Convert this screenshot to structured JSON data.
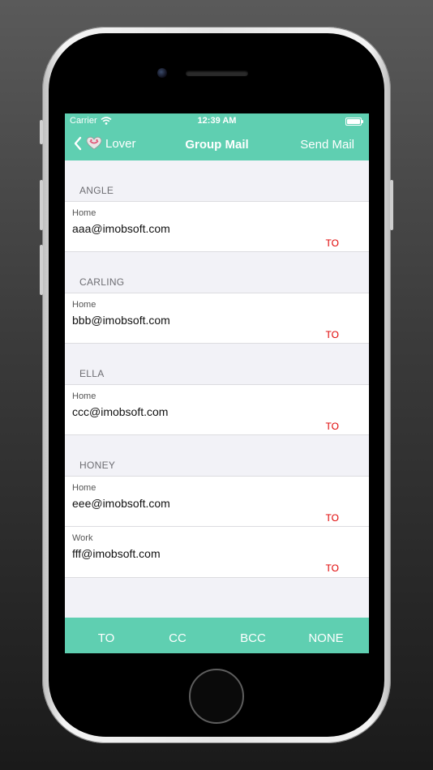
{
  "status": {
    "carrier": "Carrier",
    "time": "12:39 AM"
  },
  "nav": {
    "back_label": "Lover",
    "title": "Group Mail",
    "send_label": "Send Mail"
  },
  "sections": [
    {
      "header": "ANGLE",
      "rows": [
        {
          "label": "Home",
          "email": "aaa@imobsoft.com",
          "recipient": "TO"
        }
      ]
    },
    {
      "header": "CARLING",
      "rows": [
        {
          "label": "Home",
          "email": "bbb@imobsoft.com",
          "recipient": "TO"
        }
      ]
    },
    {
      "header": "ELLA",
      "rows": [
        {
          "label": "Home",
          "email": "ccc@imobsoft.com",
          "recipient": "TO"
        }
      ]
    },
    {
      "header": "HONEY",
      "rows": [
        {
          "label": "Home",
          "email": "eee@imobsoft.com",
          "recipient": "TO"
        },
        {
          "label": "Work",
          "email": "fff@imobsoft.com",
          "recipient": "TO"
        }
      ]
    }
  ],
  "toolbar": {
    "to_label": "TO",
    "cc_label": "CC",
    "bcc_label": "BCC",
    "none_label": "NONE"
  },
  "colors": {
    "accent": "#5fcfb1",
    "recipient": "#e00000",
    "background": "#f2f2f7"
  }
}
